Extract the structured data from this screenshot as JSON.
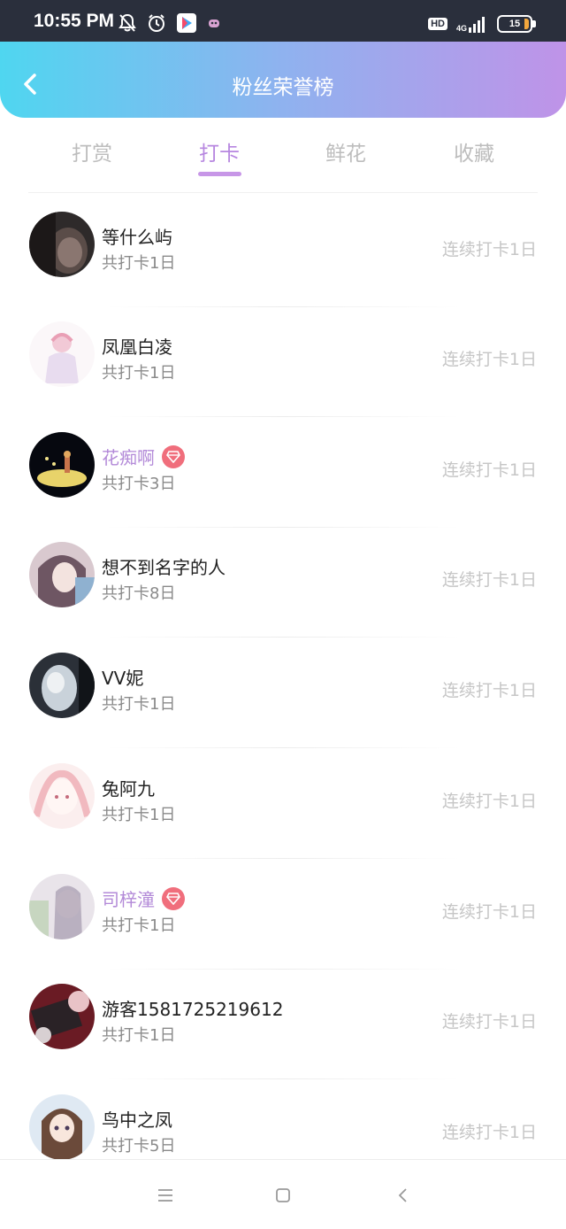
{
  "status_bar": {
    "time": "10:55 PM",
    "icons_left": [
      "mute-bell-icon",
      "alarm-icon",
      "play-store-icon",
      "app-icon"
    ],
    "hd": "HD",
    "network": "4G",
    "battery": "15"
  },
  "header": {
    "title": "粉丝荣誉榜",
    "back_icon": "chevron-left-icon",
    "gradient": [
      "#4fd6f0",
      "#bf93e8"
    ]
  },
  "tabs": [
    {
      "label": "打赏",
      "active": false
    },
    {
      "label": "打卡",
      "active": true
    },
    {
      "label": "鲜花",
      "active": false
    },
    {
      "label": "收藏",
      "active": false
    }
  ],
  "accent_color": "#b787e0",
  "rows": [
    {
      "name": "等什么屿",
      "total": "共打卡1日",
      "streak": "连续打卡1日",
      "vip": false
    },
    {
      "name": "凤凰白凌",
      "total": "共打卡1日",
      "streak": "连续打卡1日",
      "vip": false
    },
    {
      "name": "花痴啊",
      "total": "共打卡3日",
      "streak": "连续打卡1日",
      "vip": true
    },
    {
      "name": "想不到名字的人",
      "total": "共打卡8日",
      "streak": "连续打卡1日",
      "vip": false
    },
    {
      "name": "VV妮",
      "total": "共打卡1日",
      "streak": "连续打卡1日",
      "vip": false
    },
    {
      "name": "兔阿九",
      "total": "共打卡1日",
      "streak": "连续打卡1日",
      "vip": false
    },
    {
      "name": "司梓潼",
      "total": "共打卡1日",
      "streak": "连续打卡1日",
      "vip": true
    },
    {
      "name": "游客1581725219612",
      "total": "共打卡1日",
      "streak": "连续打卡1日",
      "vip": false
    },
    {
      "name": "鸟中之凤",
      "total": "共打卡5日",
      "streak": "连续打卡1日",
      "vip": false
    }
  ],
  "nav_bar": {
    "buttons": [
      "menu-icon",
      "home-square-icon",
      "back-triangle-icon"
    ]
  }
}
